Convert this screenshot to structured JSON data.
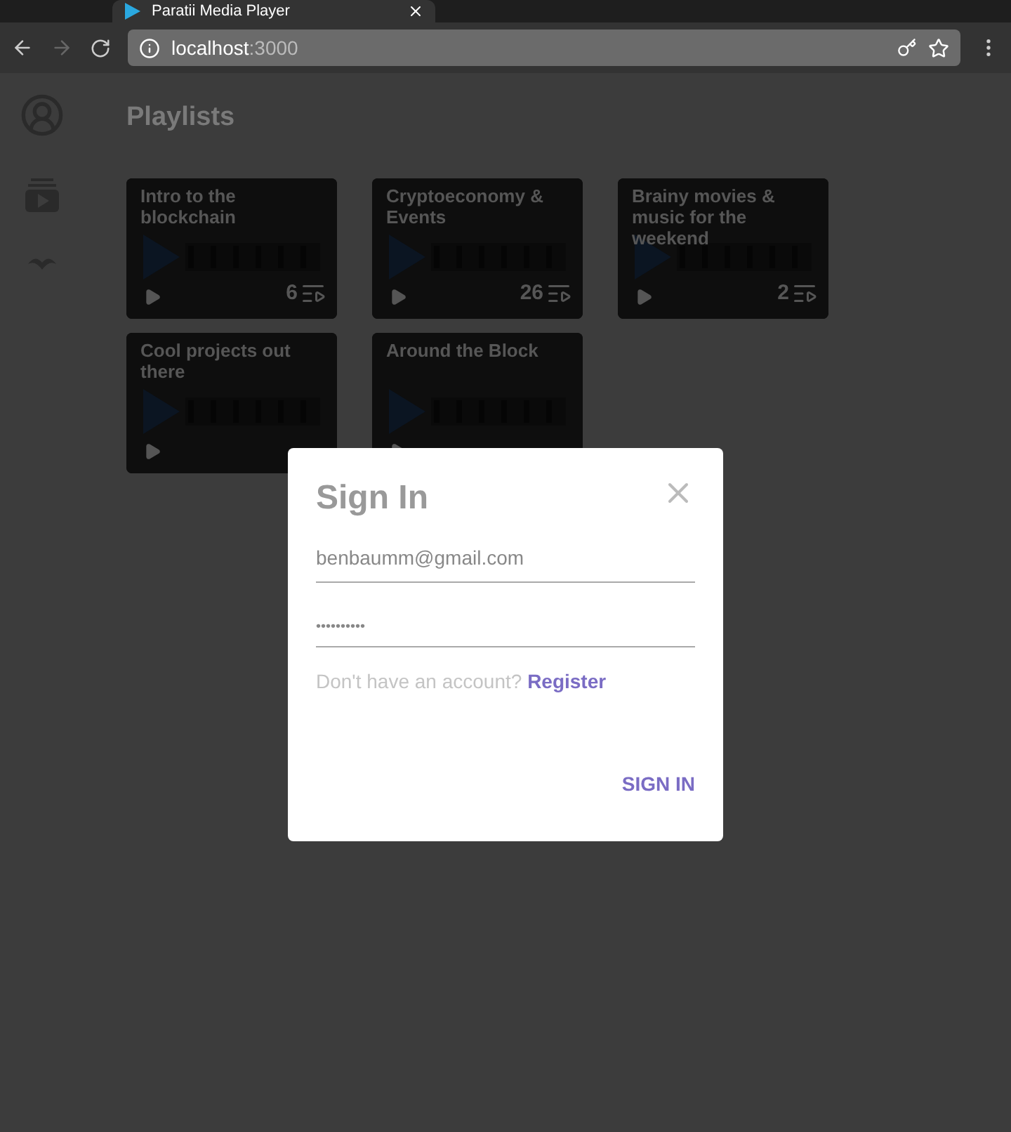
{
  "browser": {
    "tab_title": "Paratii Media Player",
    "url_host": "localhost",
    "url_port": ":3000"
  },
  "page": {
    "title": "Playlists",
    "playlists": [
      {
        "title": "Intro to the blockchain",
        "count": "6"
      },
      {
        "title": "Cryptoeconomy & Events",
        "count": "26"
      },
      {
        "title": "Brainy movies & music for the weekend",
        "count": "2"
      },
      {
        "title": "Cool projects out there"
      },
      {
        "title": "Around the Block"
      }
    ]
  },
  "dialog": {
    "title": "Sign In",
    "email": "benbaumm@gmail.com",
    "password": "••••••••••",
    "prompt": "Don't have an account?",
    "register_link": "Register",
    "submit": "SIGN IN"
  }
}
